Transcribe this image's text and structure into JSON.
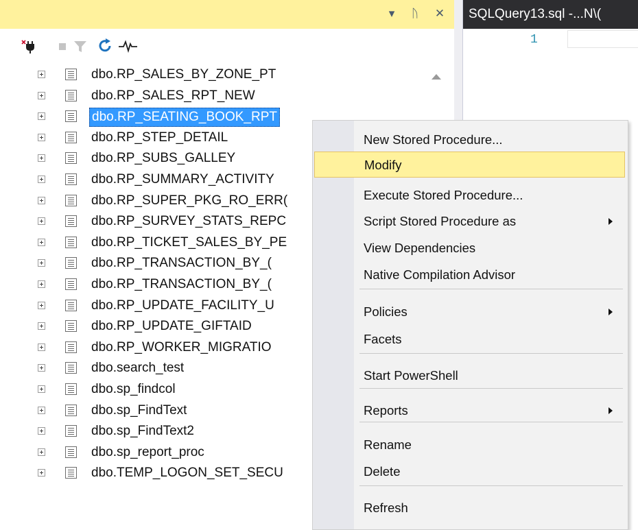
{
  "object_explorer": {
    "title_buttons": {
      "dropdown": "▾",
      "pin": "ᚢ",
      "close": "✕"
    },
    "toolbar_icons": [
      "connect-icon",
      "disconnect-icon",
      "filter-icon",
      "refresh-icon",
      "activity-monitor-icon"
    ],
    "tree_items": [
      "dbo.RP_SALES_BY_ZONE_PT",
      "dbo.RP_SALES_RPT_NEW",
      "dbo.RP_SEATING_BOOK_RPT",
      "dbo.RP_STEP_DETAIL",
      "dbo.RP_SUBS_GALLEY",
      "dbo.RP_SUMMARY_ACTIVITY",
      "dbo.RP_SUPER_PKG_RO_ERR(",
      "dbo.RP_SURVEY_STATS_REPC",
      "dbo.RP_TICKET_SALES_BY_PE",
      "dbo.RP_TRANSACTION_BY_(",
      "dbo.RP_TRANSACTION_BY_(",
      "dbo.RP_UPDATE_FACILITY_U",
      "dbo.RP_UPDATE_GIFTAID",
      "dbo.RP_WORKER_MIGRATIO",
      "dbo.search_test",
      "dbo.sp_findcol",
      "dbo.sp_FindText",
      "dbo.sp_FindText2",
      "dbo.sp_report_proc",
      "dbo.TEMP_LOGON_SET_SECU"
    ],
    "selected_item": "dbo.RP_SEATING_BOOK_RPT"
  },
  "editor": {
    "tab_title": "SQLQuery13.sql -...N\\(",
    "line_number": "1"
  },
  "context_menu": {
    "items": [
      {
        "label": "New Stored Procedure...",
        "submenu": false
      },
      {
        "label": "Modify",
        "submenu": false,
        "hovered": true
      },
      {
        "label": "Execute Stored Procedure...",
        "submenu": false
      },
      {
        "label": "Script Stored Procedure as",
        "submenu": true
      },
      {
        "label": "View Dependencies",
        "submenu": false
      },
      {
        "label": "Native Compilation Advisor",
        "submenu": false
      },
      {
        "label": "Policies",
        "submenu": true
      },
      {
        "label": "Facets",
        "submenu": false
      },
      {
        "label": "Start PowerShell",
        "submenu": false
      },
      {
        "label": "Reports",
        "submenu": true
      },
      {
        "label": "Rename",
        "submenu": false
      },
      {
        "label": "Delete",
        "submenu": false
      },
      {
        "label": "Refresh",
        "submenu": false
      }
    ]
  },
  "colors": {
    "title_bar": "#fff29d",
    "selection": "#3399ff",
    "menu_hover": "#fff29d",
    "editor_tab": "#2d2d30"
  }
}
